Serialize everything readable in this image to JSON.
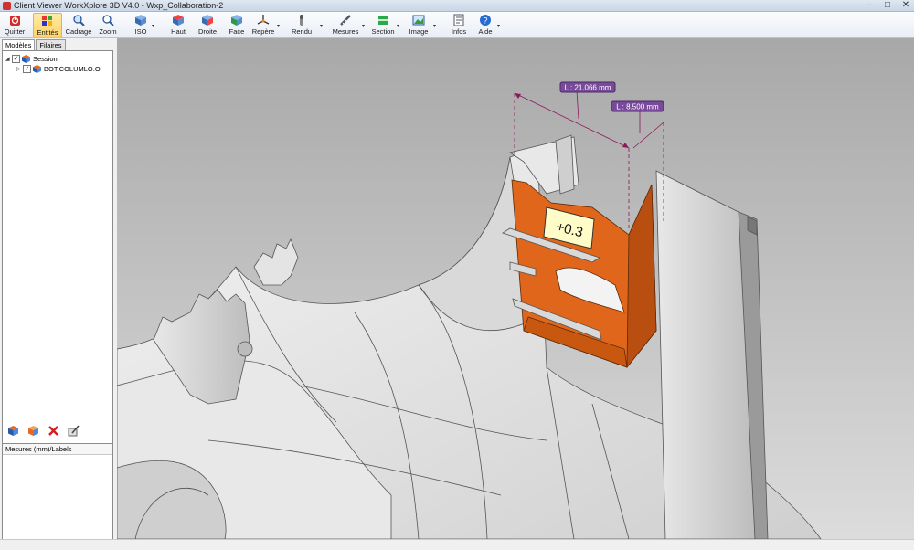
{
  "window": {
    "title": "Client Viewer WorkXplore 3D V4.0 - Wxp_Collaboration-2",
    "controls": [
      "–",
      "□",
      "✕"
    ]
  },
  "toolbar": {
    "items": [
      {
        "label": "Quitter",
        "icon": "quit-icon"
      },
      {
        "label": "Entités",
        "icon": "entities-icon",
        "active": true
      },
      {
        "label": "Cadrage",
        "icon": "fit-icon"
      },
      {
        "label": "Zoom",
        "icon": "zoom-icon"
      },
      {
        "label": "ISO",
        "icon": "iso-view-icon"
      },
      {
        "label": "Haut",
        "icon": "top-view-icon"
      },
      {
        "label": "Droite",
        "icon": "right-view-icon"
      },
      {
        "label": "Face",
        "icon": "front-view-icon"
      },
      {
        "label": "Repère",
        "icon": "axis-icon"
      },
      {
        "label": "Rendu",
        "icon": "render-icon"
      },
      {
        "label": "Mesures",
        "icon": "measure-icon"
      },
      {
        "label": "Section",
        "icon": "section-icon"
      },
      {
        "label": "Image",
        "icon": "image-icon"
      },
      {
        "label": "Infos",
        "icon": "info-icon"
      },
      {
        "label": "Aide",
        "icon": "help-icon"
      }
    ]
  },
  "left_panel": {
    "tabs": [
      "Modèles",
      "Filaires"
    ],
    "tree": [
      {
        "label": "Session",
        "checked": true,
        "expanded": true
      },
      {
        "label": "BOT.COLUMLO.O",
        "checked": true,
        "expanded": false
      }
    ],
    "measures_header": "Mesures (mm)/Labels"
  },
  "viewport": {
    "dimension_1": "L : 21.066 mm",
    "dimension_2": "L : 8.500 mm",
    "tolerance_label": "+0.3",
    "colors": {
      "background_top": "#a6a6a6",
      "background_bottom": "#d9d9d9",
      "highlight_part": "#e0661c",
      "dimension": "#8a1a5a"
    }
  }
}
